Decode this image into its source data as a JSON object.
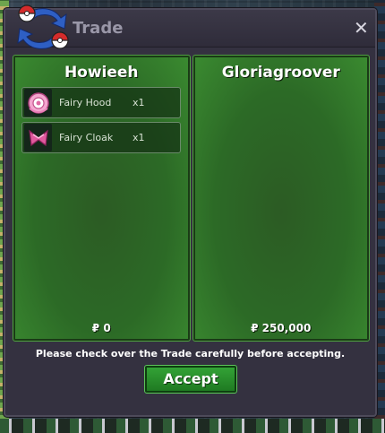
{
  "window": {
    "title": "Trade",
    "close_icon": "close-icon"
  },
  "left_panel": {
    "player_name": "Howieeh",
    "items": [
      {
        "name": "Fairy Hood",
        "qty": "x1",
        "icon": "fairy-hood-icon"
      },
      {
        "name": "Fairy Cloak",
        "qty": "x1",
        "icon": "fairy-cloak-icon"
      }
    ],
    "money": "₽ 0"
  },
  "right_panel": {
    "player_name": "Gloriagroover",
    "items": [],
    "money": "₽ 250,000"
  },
  "footer": {
    "notice": "Please check over the Trade carefully before accepting.",
    "accept_label": "Accept"
  },
  "colors": {
    "panel_green": "#2c6a26",
    "accept_green": "#2a8f2d",
    "dialog_bg": "#343140"
  }
}
